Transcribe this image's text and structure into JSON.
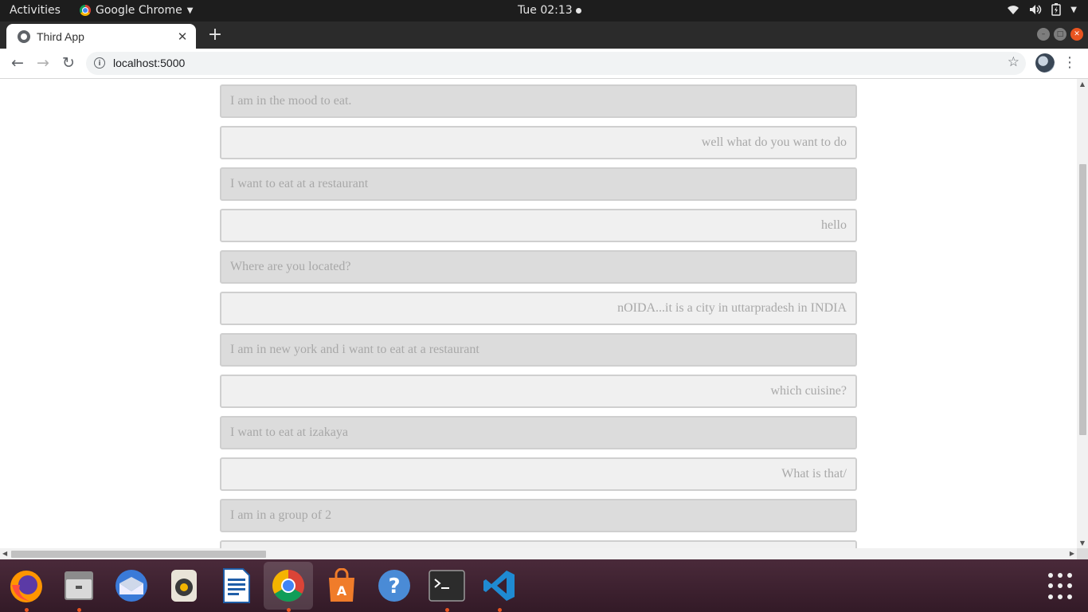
{
  "topbar": {
    "activities": "Activities",
    "app_name": "Google Chrome",
    "clock": "Tue 02:13"
  },
  "browser": {
    "tab_title": "Third App",
    "url": "localhost:5000"
  },
  "chat": {
    "messages": [
      {
        "sender": "user",
        "text": "I am in the mood to eat."
      },
      {
        "sender": "bot",
        "text": "well what do you want to do"
      },
      {
        "sender": "user",
        "text": "I want to eat at a restaurant"
      },
      {
        "sender": "bot",
        "text": "hello"
      },
      {
        "sender": "user",
        "text": "Where are you located?"
      },
      {
        "sender": "bot",
        "text": "nOIDA...it is a city in uttarpradesh in INDIA"
      },
      {
        "sender": "user",
        "text": "I am in new york and i want to eat at a restaurant"
      },
      {
        "sender": "bot",
        "text": "which cuisine?"
      },
      {
        "sender": "user",
        "text": "I want to eat at izakaya"
      },
      {
        "sender": "bot",
        "text": "What is that/"
      },
      {
        "sender": "user",
        "text": "I am in a group of 2"
      },
      {
        "sender": "bot",
        "text": ""
      }
    ]
  },
  "dock": {
    "apps": [
      "firefox-icon",
      "files-icon",
      "thunderbird-icon",
      "rhythmbox-icon",
      "libreoffice-writer-icon",
      "chrome-icon",
      "software-center-icon",
      "help-icon",
      "terminal-icon",
      "vscode-icon"
    ]
  }
}
